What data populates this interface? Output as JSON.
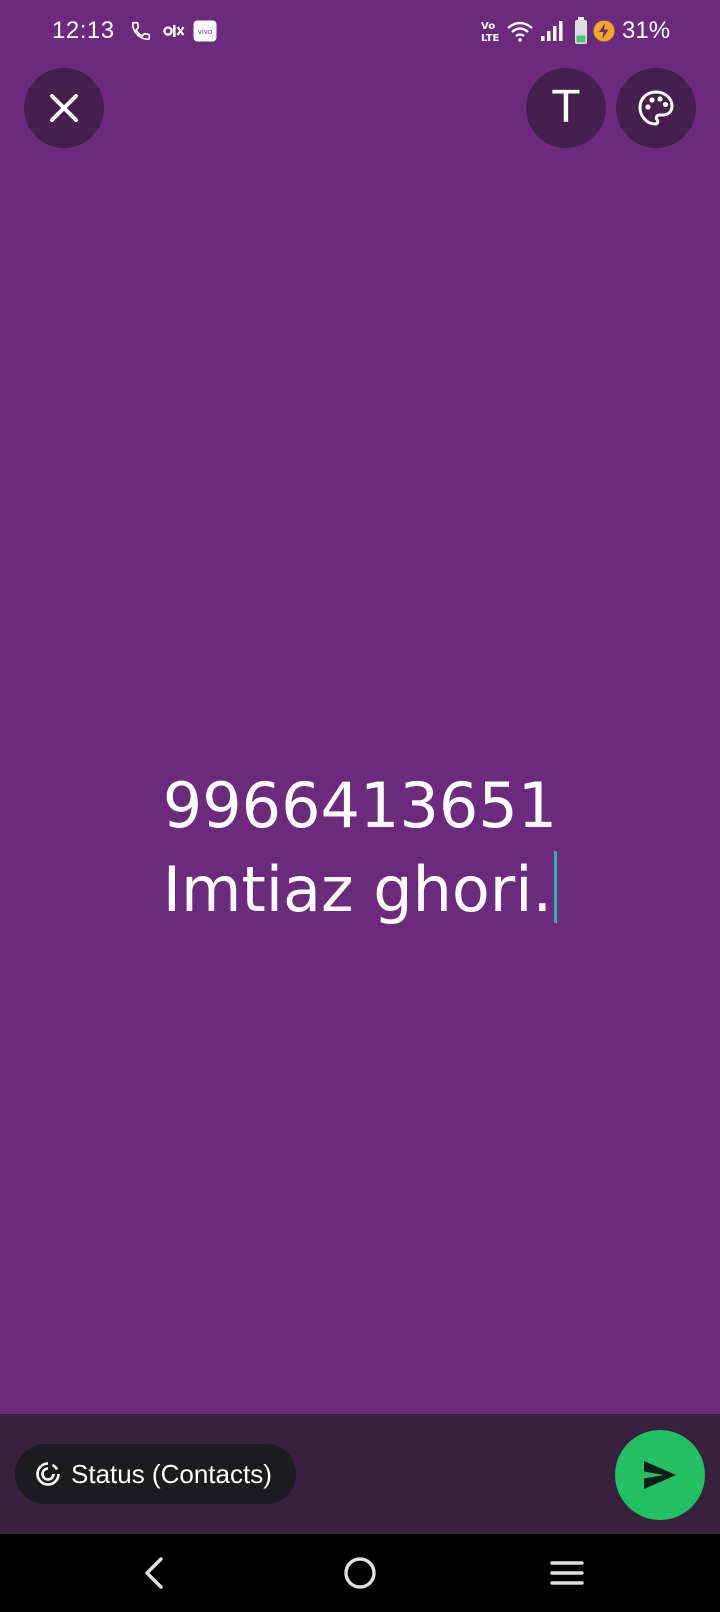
{
  "status_bar": {
    "time": "12:13",
    "network_label": "Vo)) LTE",
    "battery_percent": "31%",
    "battery_level": 0.31,
    "icons": [
      "phone-call-icon",
      "olx-icon",
      "vivo-icon",
      "volte-icon",
      "wifi-icon",
      "signal-icon",
      "battery-icon",
      "charging-icon"
    ]
  },
  "toolbar": {
    "close_icon": "close-icon",
    "text_tool_label": "T",
    "palette_icon": "palette-icon"
  },
  "status_editor": {
    "lines": [
      "9966413651",
      "Imtiaz ghori."
    ],
    "background_color": "#6b2a7b",
    "caret_color": "#2bb3a3"
  },
  "bottom_bar": {
    "audience_label": "Status (Contacts)",
    "audience_icon": "status-ring-icon",
    "send_icon": "send-icon",
    "send_color": "#21c063"
  },
  "nav_bar": {
    "icons": [
      "back-icon",
      "home-icon",
      "recents-icon"
    ]
  }
}
